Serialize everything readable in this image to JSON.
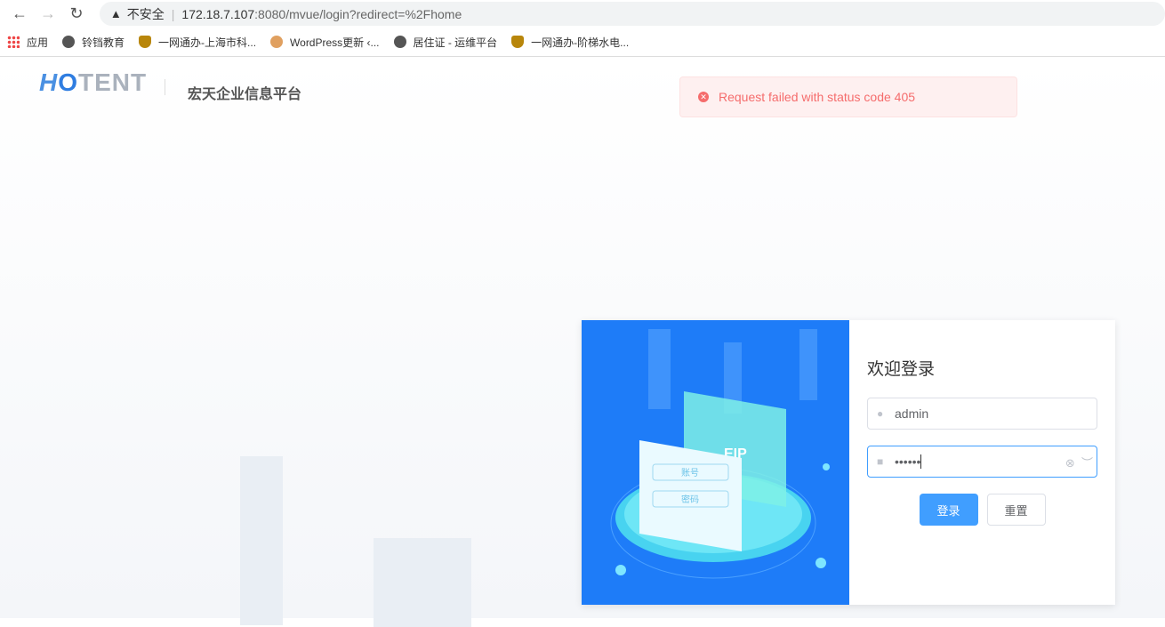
{
  "browser": {
    "security_label": "不安全",
    "url_host": "172.18.7.107",
    "url_rest": ":8080/mvue/login?redirect=%2Fhome",
    "bookmarks": [
      "应用",
      "铃铛教育",
      "一网通办-上海市科...",
      "WordPress更新 ‹...",
      "居住证 - 运维平台",
      "一网通办-阶梯水电..."
    ]
  },
  "header": {
    "logo": "HOTENT",
    "title": "宏天企业信息平台"
  },
  "message": {
    "text": "Request failed with status code 405",
    "color": "#f56c6c"
  },
  "illustration": {
    "badge": "EIP",
    "field1": "账号",
    "field2": "密码"
  },
  "login": {
    "welcome": "欢迎登录",
    "username": "admin",
    "password": "••••••",
    "login_label": "登录",
    "reset_label": "重置"
  }
}
